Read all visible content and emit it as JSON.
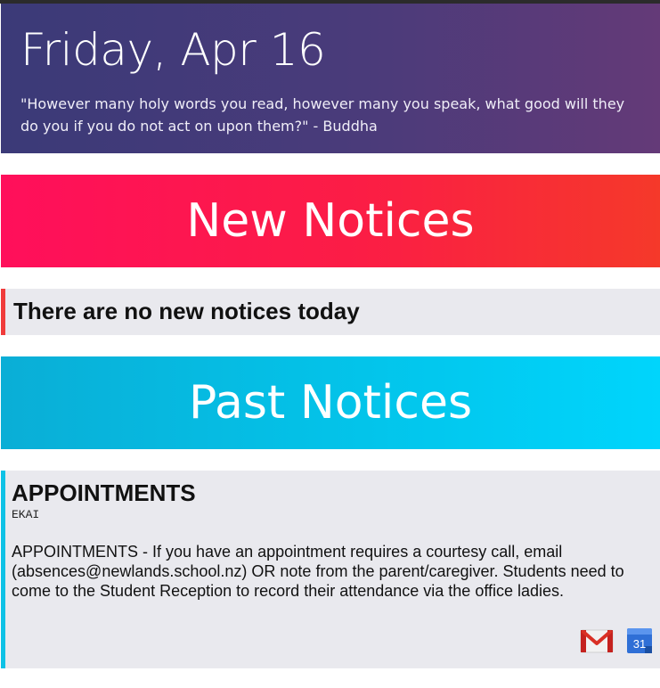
{
  "header": {
    "date": "Friday, Apr 16",
    "quote": "\"However many holy words you read, however many you speak, what good will they do you if you do not act on upon them?\" - Buddha"
  },
  "new_notices": {
    "heading": "New Notices",
    "empty_message": "There are no new notices today"
  },
  "past_notices": {
    "heading": "Past Notices",
    "items": [
      {
        "title": "APPOINTMENTS",
        "author": "EKAI",
        "body": "APPOINTMENTS - If you have an appointment requires a courtesy call, email (absences@newlands.school.nz) OR note from the parent/caregiver. Students need to come to the Student Reception to record their attendance via the office ladies."
      }
    ]
  },
  "icons": {
    "gmail": "gmail-icon",
    "calendar": "calendar-icon",
    "calendar_day": "31"
  },
  "colors": {
    "header_start": "#3b3a78",
    "header_end": "#643a78",
    "new_start": "#ff0f5b",
    "new_end": "#f5392a",
    "past_start": "#0aaed6",
    "past_end": "#00d5fc",
    "no_new_accent": "#f03b3b",
    "notice_accent": "#0ec2e6"
  }
}
